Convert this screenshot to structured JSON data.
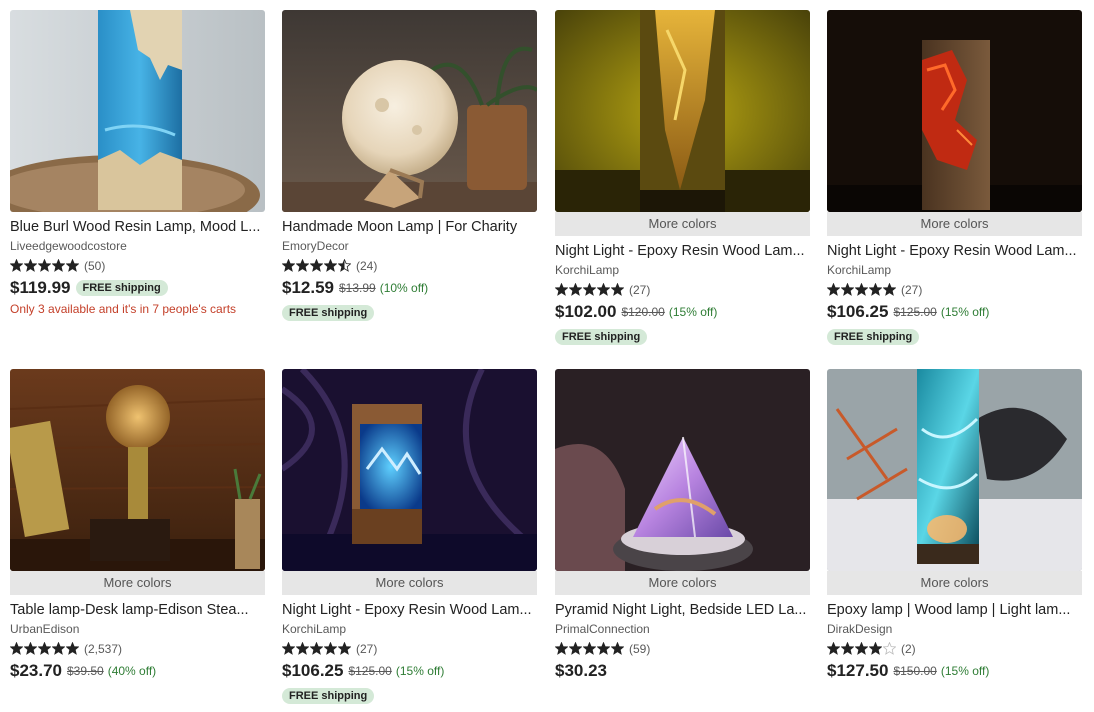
{
  "colors": {
    "badge_bg": "#d4e9d7",
    "discount": "#2f7d35",
    "scarcity": "#c4402a",
    "star": "#222222"
  },
  "listings": [
    {
      "title": "Blue Burl Wood Resin Lamp, Mood L...",
      "shop": "Liveedgewoodcostore",
      "rating": 5,
      "reviews": "(50)",
      "price": "$119.99",
      "original_price": "",
      "discount": "",
      "free_shipping": "FREE shipping",
      "more_colors": "",
      "note": "Only 3 available and it's in 7 people's carts",
      "image": "blue-resin-lamp"
    },
    {
      "title": "Handmade Moon Lamp | For Charity",
      "shop": "EmoryDecor",
      "rating": 4.5,
      "reviews": "(24)",
      "price": "$12.59",
      "original_price": "$13.99",
      "discount": "(10% off)",
      "free_shipping": "FREE shipping",
      "more_colors": "",
      "note": "",
      "image": "moon-lamp"
    },
    {
      "title": "Night Light - Epoxy Resin Wood Lam...",
      "shop": "KorchiLamp",
      "rating": 5,
      "reviews": "(27)",
      "price": "$102.00",
      "original_price": "$120.00",
      "discount": "(15% off)",
      "free_shipping": "FREE shipping",
      "more_colors": "More colors",
      "note": "",
      "image": "yellow-resin-lamp"
    },
    {
      "title": "Night Light - Epoxy Resin Wood Lam...",
      "shop": "KorchiLamp",
      "rating": 5,
      "reviews": "(27)",
      "price": "$106.25",
      "original_price": "$125.00",
      "discount": "(15% off)",
      "free_shipping": "FREE shipping",
      "more_colors": "More colors",
      "note": "",
      "image": "red-resin-lamp"
    },
    {
      "title": "Table lamp-Desk lamp-Edison Stea...",
      "shop": "UrbanEdison",
      "rating": 5,
      "reviews": "(2,537)",
      "price": "$23.70",
      "original_price": "$39.50",
      "discount": "(40% off)",
      "free_shipping": "",
      "more_colors": "More colors",
      "note": "",
      "image": "edison-lamp"
    },
    {
      "title": "Night Light - Epoxy Resin Wood Lam...",
      "shop": "KorchiLamp",
      "rating": 5,
      "reviews": "(27)",
      "price": "$106.25",
      "original_price": "$125.00",
      "discount": "(15% off)",
      "free_shipping": "FREE shipping",
      "more_colors": "More colors",
      "note": "",
      "image": "blue-cube-lamp"
    },
    {
      "title": "Pyramid Night Light, Bedside LED La...",
      "shop": "PrimalConnection",
      "rating": 5,
      "reviews": "(59)",
      "price": "$30.23",
      "original_price": "",
      "discount": "",
      "free_shipping": "",
      "more_colors": "More colors",
      "note": "",
      "image": "pyramid-lamp"
    },
    {
      "title": "Epoxy lamp | Wood lamp | Light lam...",
      "shop": "DirakDesign",
      "rating": 4,
      "reviews": "(2)",
      "price": "$127.50",
      "original_price": "$150.00",
      "discount": "(15% off)",
      "free_shipping": "",
      "more_colors": "More colors",
      "note": "",
      "image": "teal-resin-lamp"
    }
  ]
}
